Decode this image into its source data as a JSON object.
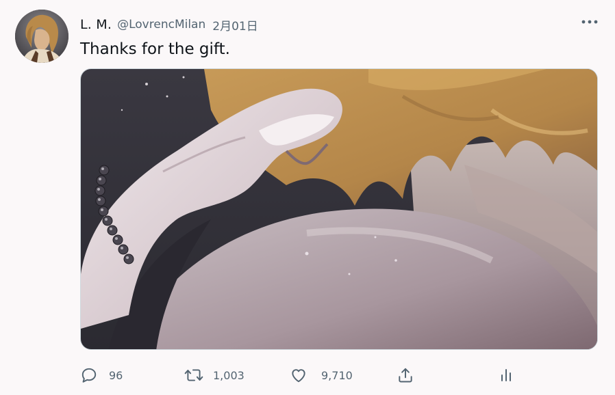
{
  "tweet": {
    "display_name": "L. M.",
    "handle": "@LovrencMilan",
    "date": "2月01日",
    "text": "Thanks for the gift.",
    "media": {
      "description_icon": "illustration-image"
    }
  },
  "actions": {
    "reply_count": "96",
    "retweet_count": "1,003",
    "like_count": "9,710"
  },
  "icons": {
    "more": "more-icon",
    "reply": "reply-icon",
    "retweet": "retweet-icon",
    "like": "heart-icon",
    "share": "share-icon",
    "analytics": "analytics-icon"
  },
  "colors": {
    "text_primary": "#0f1419",
    "text_secondary": "#536471",
    "background": "#fbf8f9"
  }
}
